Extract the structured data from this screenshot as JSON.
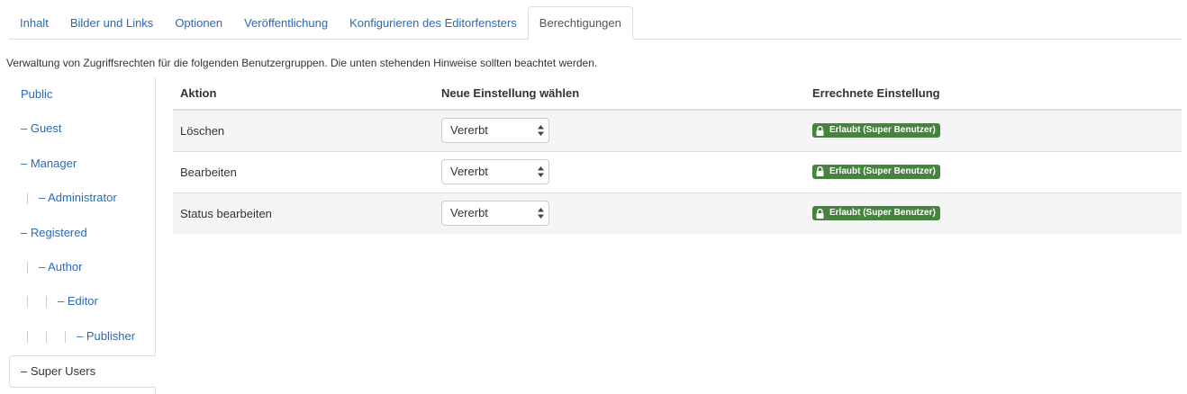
{
  "tabs": [
    {
      "label": "Inhalt",
      "active": false
    },
    {
      "label": "Bilder und Links",
      "active": false
    },
    {
      "label": "Optionen",
      "active": false
    },
    {
      "label": "Veröffentlichung",
      "active": false
    },
    {
      "label": "Konfigurieren des Editorfensters",
      "active": false
    },
    {
      "label": "Berechtigungen",
      "active": true
    }
  ],
  "intro_text": "Verwaltung von Zugriffsrechten für die folgenden Benutzergruppen. Die unten stehenden Hinweise sollten beachtet werden.",
  "groups": [
    {
      "label": "Public"
    },
    {
      "label": "– Guest"
    },
    {
      "label": "– Manager"
    },
    {
      "label": "– Administrator"
    },
    {
      "label": "– Registered"
    },
    {
      "label": "– Author"
    },
    {
      "label": "– Editor"
    },
    {
      "label": "– Publisher"
    },
    {
      "label": "– Super Users"
    }
  ],
  "table": {
    "headers": {
      "action": "Aktion",
      "new_setting": "Neue Einstellung wählen",
      "calculated": "Errechnete Einstellung"
    },
    "rows": [
      {
        "action": "Löschen",
        "select_value": "Vererbt",
        "calculated": "Erlaubt (Super Benutzer)"
      },
      {
        "action": "Bearbeiten",
        "select_value": "Vererbt",
        "calculated": "Erlaubt (Super Benutzer)"
      },
      {
        "action": "Status bearbeiten",
        "select_value": "Vererbt",
        "calculated": "Erlaubt (Super Benutzer)"
      }
    ]
  },
  "icons": {
    "lock": "lock-icon",
    "select_arrows": "select-arrows-icon"
  },
  "colors": {
    "link": "#2a69b8",
    "badge_success": "#46833f",
    "border": "#dddddd",
    "row_stripe": "#f5f5f5"
  }
}
